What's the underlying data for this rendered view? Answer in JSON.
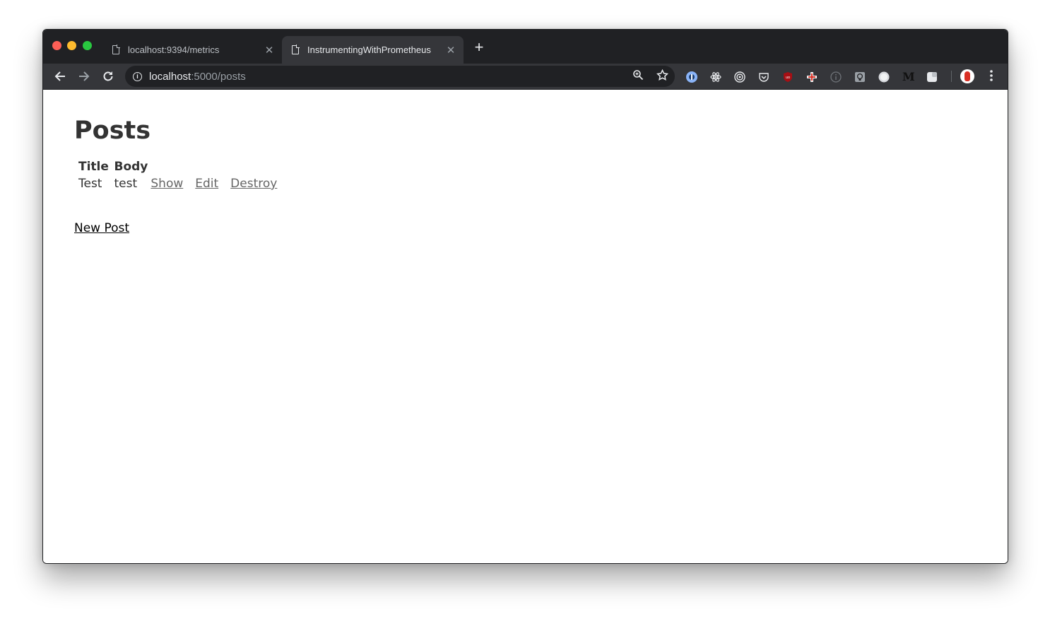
{
  "browser": {
    "tabs": [
      {
        "title": "localhost:9394/metrics",
        "close": "✕"
      },
      {
        "title": "InstrumentingWithPrometheus",
        "close": "✕"
      }
    ],
    "new_tab": "+",
    "url_host": "localhost",
    "url_path": ":5000/posts",
    "extension_icons": [
      {
        "name": "1password-icon",
        "color": "#7fb2e5"
      },
      {
        "name": "react-devtools-icon",
        "color": "#e8eaed"
      },
      {
        "name": "target-icon",
        "color": "#e8eaed"
      },
      {
        "name": "pocket-icon",
        "color": "#e8eaed"
      },
      {
        "name": "ublock-icon",
        "color": "#a50f14"
      },
      {
        "name": "cross-icon",
        "color": "#f2f2f2"
      },
      {
        "name": "info-ext-icon",
        "color": "#9aa0a6"
      },
      {
        "name": "lightbulb-icon",
        "color": "#e8eaed"
      },
      {
        "name": "circle-ext-icon",
        "color": "#e8eaed"
      },
      {
        "name": "medium-icon",
        "color": "#000000"
      },
      {
        "name": "square-ext-icon",
        "color": "#e8eaed"
      }
    ],
    "medium_label": "M"
  },
  "page": {
    "title": "Posts",
    "headers": {
      "title": "Title",
      "body": "Body"
    },
    "rows": [
      {
        "title": "Test",
        "body": "test",
        "show": "Show",
        "edit": "Edit",
        "destroy": "Destroy"
      }
    ],
    "new_post": "New Post"
  }
}
